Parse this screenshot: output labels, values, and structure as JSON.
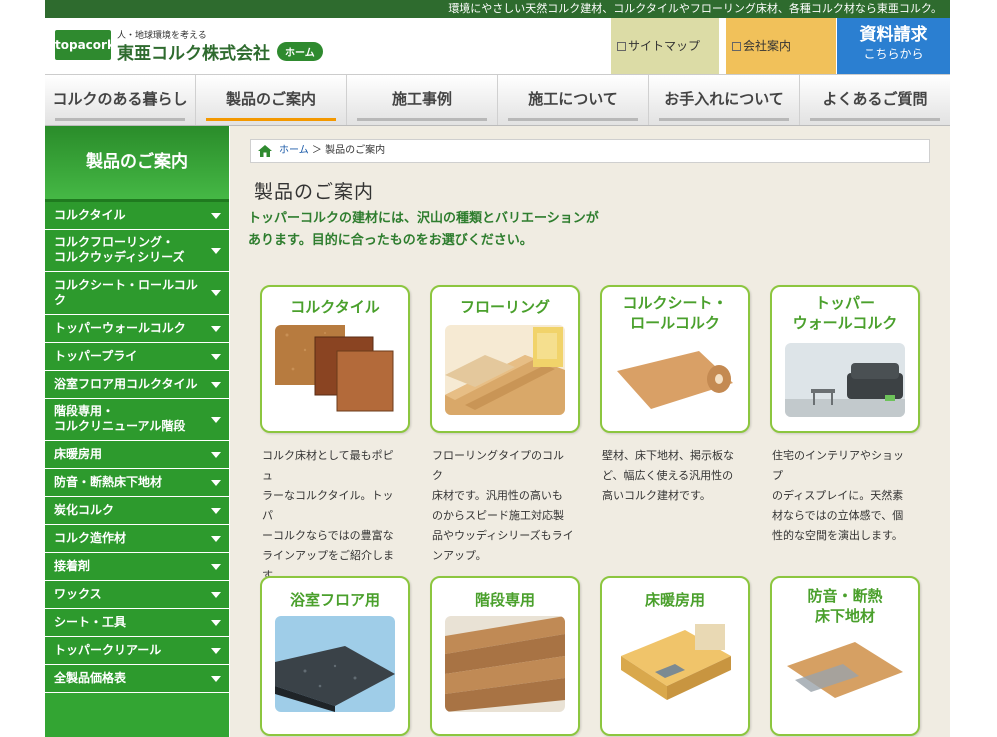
{
  "topbar": {
    "text": "環境にやさしい天然コルク建材、コルクタイルやフローリング床材、各種コルク材なら東亜コルク。"
  },
  "header": {
    "logo": "topacork",
    "tagline": "人・地球環境を考える",
    "company": "東亜コルク株式会社",
    "home_label": "ホーム",
    "sitemap": "サイトマップ",
    "company_info": "会社案内",
    "request_main": "資料請求",
    "request_sub": "こちらから"
  },
  "nav": [
    {
      "label": "コルクのある暮らし"
    },
    {
      "label": "製品のご案内"
    },
    {
      "label": "施工事例"
    },
    {
      "label": "施工について"
    },
    {
      "label": "お手入れについて"
    },
    {
      "label": "よくあるご質問"
    }
  ],
  "sidebar": {
    "title": "製品のご案内",
    "items": [
      {
        "label": "コルクタイル"
      },
      {
        "label": "コルクフローリング・",
        "label2": "コルクウッディシリーズ"
      },
      {
        "label": "コルクシート・ロールコルク"
      },
      {
        "label": "トッパーウォールコルク"
      },
      {
        "label": "トッパープライ"
      },
      {
        "label": "浴室フロア用コルクタイル"
      },
      {
        "label": "階段専用・",
        "label2": "コルクリニューアル階段"
      },
      {
        "label": "床暖房用"
      },
      {
        "label": "防音・断熱床下地材"
      },
      {
        "label": "炭化コルク"
      },
      {
        "label": "コルク造作材"
      },
      {
        "label": "接着剤"
      },
      {
        "label": "ワックス"
      },
      {
        "label": "シート・工具"
      },
      {
        "label": "トッパークリアール"
      },
      {
        "label": "全製品価格表"
      }
    ]
  },
  "breadcrumb": {
    "home": "ホーム",
    "sep": "＞",
    "current": "製品のご案内"
  },
  "main": {
    "title": "製品のご案内",
    "intro1": "トッパーコルクの建材には、沢山の種類とバリエーションが",
    "intro2": "あります。目的に合ったものをお選びください。"
  },
  "cards": [
    {
      "title": "コルクタイル",
      "lines": [
        "コルク床材として最もポピュ",
        "ラーなコルクタイル。トッパ",
        "ーコルクならではの豊富な",
        "ラインアップをご紹介しま",
        "す。"
      ]
    },
    {
      "title": "フローリング",
      "lines": [
        "フローリングタイプのコルク",
        "床材です。汎用性の高いも",
        "のからスピード施工対応製",
        "品やウッディシリーズもライ",
        "ンアップ。"
      ]
    },
    {
      "title": "コルクシート・",
      "title2": "ロールコルク",
      "lines": [
        "壁材、床下地材、掲示板な",
        "ど、幅広く使える汎用性の",
        "高いコルク建材です。"
      ]
    },
    {
      "title": "トッパー",
      "title2": "ウォールコルク",
      "lines": [
        "住宅のインテリアやショップ",
        "のディスプレイに。天然素",
        "材ならではの立体感で、個",
        "性的な空間を演出します。"
      ]
    },
    {
      "title": "浴室フロア用"
    },
    {
      "title": "階段専用"
    },
    {
      "title": "床暖房用"
    },
    {
      "title": "防音・断熱",
      "title2": "床下地材"
    }
  ],
  "colors": {
    "brand_green": "#33a533",
    "dark_green": "#2e6b2e",
    "orange": "#f39800",
    "blue": "#2b7fd1",
    "content_bg": "#f0ece2",
    "card_border": "#8cc63f"
  }
}
